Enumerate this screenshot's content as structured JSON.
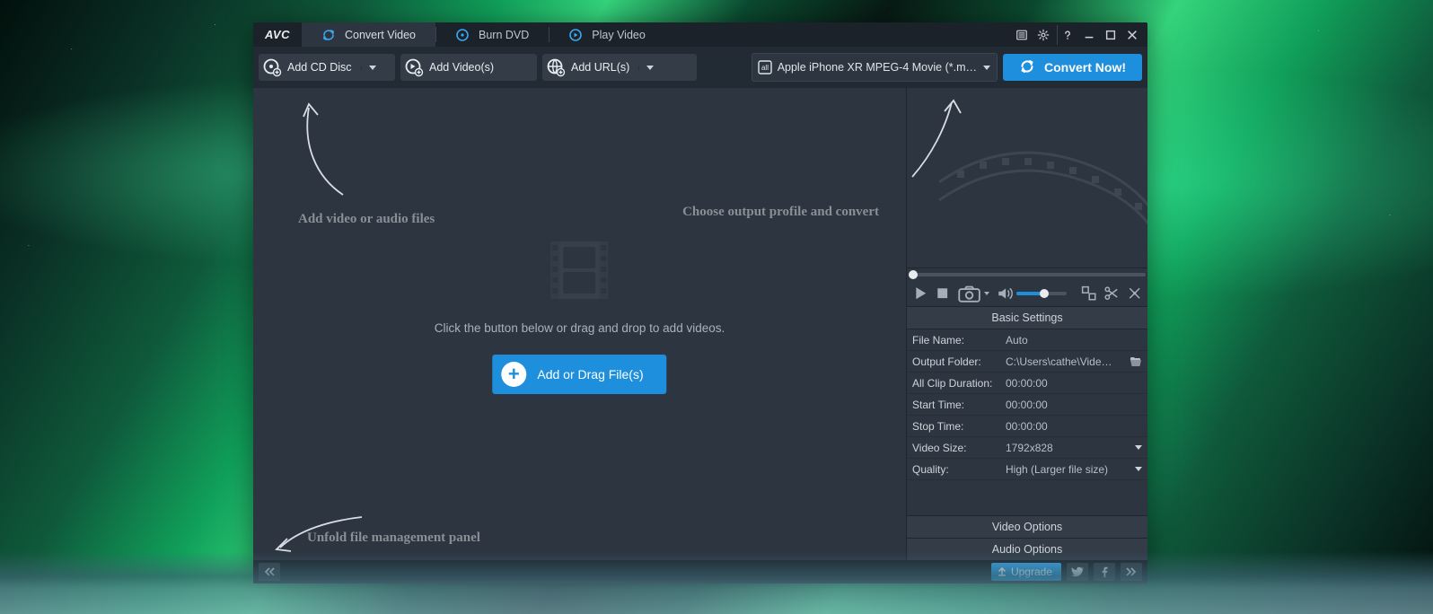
{
  "logo": "AVC",
  "tabs": [
    {
      "label": "Convert Video",
      "active": true
    },
    {
      "label": "Burn DVD",
      "active": false
    },
    {
      "label": "Play Video",
      "active": false
    }
  ],
  "toolbar": {
    "add_cd": "Add CD Disc",
    "add_videos": "Add Video(s)",
    "add_urls": "Add URL(s)",
    "profile": "Apple iPhone XR MPEG-4 Movie (*.m…",
    "convert": "Convert Now!"
  },
  "hints": {
    "add": "Add video or audio files",
    "output": "Choose output profile and convert",
    "unfold": "Unfold file management panel"
  },
  "placeholder": {
    "text": "Click the button below or drag and drop to add videos.",
    "button": "Add or Drag File(s)"
  },
  "settings": {
    "header": "Basic Settings",
    "rows": {
      "file_name": {
        "k": "File Name:",
        "v": "Auto"
      },
      "output_folder": {
        "k": "Output Folder:",
        "v": "C:\\Users\\cathe\\Videos\\..."
      },
      "clip_duration": {
        "k": "All Clip Duration:",
        "v": "00:00:00"
      },
      "start_time": {
        "k": "Start Time:",
        "v": "00:00:00"
      },
      "stop_time": {
        "k": "Stop Time:",
        "v": "00:00:00"
      },
      "video_size": {
        "k": "Video Size:",
        "v": "1792x828"
      },
      "quality": {
        "k": "Quality:",
        "v": "High (Larger file size)"
      }
    },
    "video_options": "Video Options",
    "audio_options": "Audio Options"
  },
  "status": {
    "upgrade": "Upgrade"
  }
}
